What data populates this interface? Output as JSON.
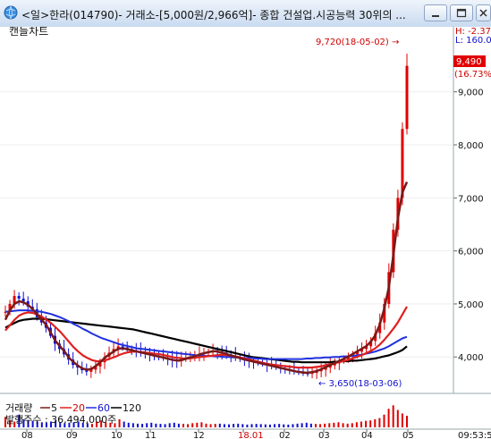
{
  "window": {
    "title": "<일>한라(014790)- 거래소-[5,000원/2,966억]- 종합 건설업.시공능력 30위의 ..."
  },
  "icons": {
    "app": "globe-icon",
    "minimize": "minimize-icon",
    "maximize": "maximize-icon",
    "close": "close-icon"
  },
  "panel_title": "캔들차트",
  "high_label": "H: -2.37",
  "low_label": "L: 160.0",
  "price_current": "9,490",
  "price_change": "(16.73%)",
  "max_annotation": "9,720(18-05-02) →",
  "min_annotation": "← 3,650(18-03-06)",
  "volume_legend": {
    "prefix": "거래량",
    "ma5": "5",
    "ma20": "20",
    "ma60": "60",
    "ma120": "120"
  },
  "shares_label": "발행주수 : 36,494,000주",
  "clock": "09:53:5",
  "colors": {
    "up": "#e00000",
    "down": "#1010d0",
    "ma5": "#7a1a1a",
    "ma20": "#e02020",
    "ma60": "#2030e0",
    "ma120": "#000000",
    "current_price_box": "#e00000"
  },
  "chart_data": {
    "type": "candlestick",
    "price_axis_ticks": [
      "9,000",
      "8,000",
      "7,000",
      "6,000",
      "5,000",
      "4,000"
    ],
    "ylim": [
      3300,
      10000
    ],
    "x_tick_labels": [
      "08",
      "09",
      "10",
      "11",
      "12",
      "18.01",
      "02",
      "03",
      "04",
      "05"
    ],
    "max_point": {
      "date": "18-05-02",
      "value": 9720
    },
    "min_point": {
      "date": "18-03-06",
      "value": 3650
    },
    "last_close": 9490,
    "price_series_approx": [
      4850,
      5000,
      5150,
      5100,
      5050,
      4950,
      4900,
      4750,
      4650,
      4550,
      4400,
      4250,
      4150,
      4050,
      3950,
      3850,
      3800,
      3750,
      3720,
      3760,
      3820,
      3900,
      4000,
      4080,
      4150,
      4200,
      4180,
      4150,
      4120,
      4100,
      4080,
      4060,
      4040,
      4020,
      4000,
      3980,
      3960,
      3940,
      3920,
      3950,
      3980,
      4000,
      4030,
      4060,
      4080,
      4100,
      4120,
      4100,
      4080,
      4050,
      4020,
      3990,
      3960,
      3940,
      3920,
      3900,
      3880,
      3860,
      3840,
      3820,
      3800,
      3780,
      3760,
      3740,
      3720,
      3700,
      3690,
      3680,
      3700,
      3730,
      3760,
      3800,
      3840,
      3880,
      3920,
      3960,
      4000,
      4050,
      4100,
      4150,
      4200,
      4300,
      4450,
      4650,
      5000,
      5600,
      6400,
      7000,
      8300,
      9490
    ],
    "ma_series_approx": {
      "ma5": [
        4700,
        4880,
        5000,
        5050,
        5030,
        4980,
        4900,
        4800,
        4700,
        4600,
        4450,
        4300,
        4200,
        4100,
        3980,
        3900,
        3830,
        3780,
        3760,
        3780,
        3840,
        3920,
        4000,
        4060,
        4120,
        4160,
        4160,
        4140,
        4120,
        4100,
        4080,
        4060,
        4040,
        4020,
        4000,
        3980,
        3960,
        3940,
        3930,
        3950,
        3980,
        4000,
        4030,
        4060,
        4080,
        4100,
        4110,
        4090,
        4070,
        4040,
        4010,
        3990,
        3960,
        3940,
        3920,
        3900,
        3880,
        3860,
        3840,
        3820,
        3800,
        3780,
        3760,
        3740,
        3720,
        3710,
        3700,
        3710,
        3730,
        3760,
        3800,
        3840,
        3880,
        3920,
        3960,
        4000,
        4050,
        4100,
        4150,
        4200,
        4280,
        4400,
        4600,
        4900,
        5300,
        5900,
        6600,
        7100,
        7300
      ],
      "ma20": [
        4500,
        4600,
        4700,
        4780,
        4820,
        4840,
        4830,
        4800,
        4760,
        4700,
        4640,
        4560,
        4480,
        4380,
        4280,
        4180,
        4100,
        4030,
        3980,
        3940,
        3920,
        3920,
        3940,
        3970,
        4000,
        4040,
        4070,
        4090,
        4100,
        4100,
        4090,
        4080,
        4070,
        4060,
        4050,
        4030,
        4010,
        3990,
        3980,
        3970,
        3970,
        3980,
        3990,
        4000,
        4010,
        4020,
        4030,
        4040,
        4040,
        4030,
        4020,
        4000,
        3980,
        3960,
        3940,
        3920,
        3900,
        3880,
        3860,
        3850,
        3840,
        3830,
        3820,
        3810,
        3800,
        3800,
        3800,
        3800,
        3810,
        3820,
        3840,
        3860,
        3880,
        3900,
        3920,
        3940,
        3970,
        4000,
        4030,
        4070,
        4110,
        4160,
        4230,
        4320,
        4420,
        4530,
        4650,
        4800,
        4950
      ],
      "ma60": [
        4850,
        4860,
        4870,
        4880,
        4880,
        4880,
        4870,
        4860,
        4850,
        4830,
        4810,
        4780,
        4750,
        4710,
        4670,
        4620,
        4580,
        4530,
        4490,
        4440,
        4400,
        4360,
        4330,
        4300,
        4270,
        4240,
        4220,
        4200,
        4180,
        4160,
        4150,
        4140,
        4130,
        4120,
        4110,
        4100,
        4090,
        4080,
        4070,
        4060,
        4050,
        4040,
        4030,
        4030,
        4020,
        4020,
        4010,
        4010,
        4000,
        4000,
        3990,
        3990,
        3980,
        3980,
        3980,
        3970,
        3970,
        3960,
        3960,
        3960,
        3960,
        3960,
        3960,
        3960,
        3960,
        3960,
        3970,
        3970,
        3980,
        3980,
        3990,
        3990,
        4000,
        4000,
        4010,
        4010,
        4020,
        4030,
        4040,
        4060,
        4080,
        4100,
        4130,
        4160,
        4200,
        4250,
        4300,
        4350,
        4380
      ],
      "ma120": [
        4550,
        4600,
        4640,
        4680,
        4700,
        4710,
        4720,
        4720,
        4720,
        4710,
        4700,
        4690,
        4680,
        4670,
        4660,
        4650,
        4640,
        4630,
        4620,
        4610,
        4600,
        4590,
        4580,
        4570,
        4560,
        4550,
        4540,
        4530,
        4520,
        4500,
        4480,
        4460,
        4440,
        4420,
        4400,
        4380,
        4360,
        4340,
        4320,
        4300,
        4280,
        4260,
        4240,
        4220,
        4200,
        4180,
        4160,
        4140,
        4120,
        4100,
        4080,
        4060,
        4040,
        4020,
        4000,
        3990,
        3980,
        3970,
        3960,
        3950,
        3940,
        3930,
        3920,
        3910,
        3910,
        3900,
        3900,
        3900,
        3900,
        3900,
        3900,
        3900,
        3910,
        3910,
        3920,
        3920,
        3930,
        3930,
        3940,
        3950,
        3960,
        3970,
        3990,
        4010,
        4030,
        4060,
        4090,
        4130,
        4200
      ]
    },
    "volume_approx": [
      0.45,
      0.3,
      0.25,
      0.55,
      0.35,
      0.3,
      0.28,
      0.25,
      0.22,
      0.2,
      0.25,
      0.3,
      0.22,
      0.18,
      0.2,
      0.22,
      0.25,
      0.2,
      0.18,
      0.15,
      0.25,
      0.3,
      0.22,
      0.2,
      0.18,
      0.35,
      0.25,
      0.2,
      0.18,
      0.16,
      0.15,
      0.18,
      0.2,
      0.16,
      0.15,
      0.14,
      0.18,
      0.2,
      0.16,
      0.15,
      0.14,
      0.18,
      0.2,
      0.22,
      0.16,
      0.14,
      0.15,
      0.16,
      0.14,
      0.13,
      0.15,
      0.16,
      0.14,
      0.12,
      0.14,
      0.15,
      0.14,
      0.13,
      0.12,
      0.14,
      0.15,
      0.13,
      0.12,
      0.14,
      0.16,
      0.18,
      0.2,
      0.16,
      0.15,
      0.14,
      0.16,
      0.18,
      0.2,
      0.22,
      0.18,
      0.16,
      0.18,
      0.22,
      0.25,
      0.28,
      0.3,
      0.35,
      0.4,
      0.55,
      0.8,
      0.95,
      0.75,
      0.6,
      0.5
    ],
    "legend": [
      "거래량",
      "5",
      "20",
      "60",
      "120"
    ]
  }
}
